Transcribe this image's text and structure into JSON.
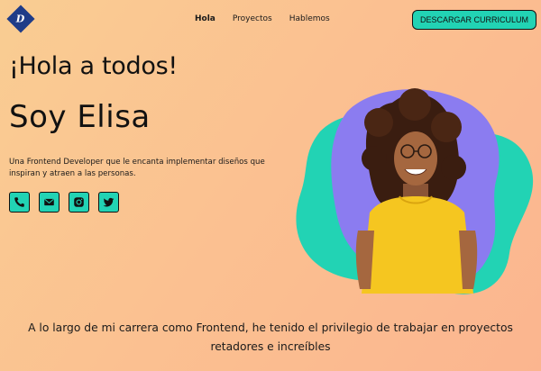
{
  "header": {
    "logo_letter": "D",
    "nav": [
      "Hola",
      "Proyectos",
      "Hablemos"
    ],
    "cv_button": "DESCARGAR CURRICULUM"
  },
  "hero": {
    "greeting": "¡Hola a todos!",
    "name": "Soy Elisa",
    "description": "Una Frontend Developer que le encanta implementar diseños que inspiran y atraen a las personas.",
    "socials": [
      "phone-icon",
      "mail-icon",
      "instagram-icon",
      "twitter-icon"
    ]
  },
  "career": {
    "line1": "A lo largo de mi carrera como Frontend, he tenido el privilegio de trabajar en proyectos",
    "line2": "retadores e increíbles"
  },
  "colors": {
    "accent": "#22d3b4",
    "blob_purple": "#8b7cf0",
    "logo": "#1f3c88",
    "shirt": "#f5c620"
  }
}
